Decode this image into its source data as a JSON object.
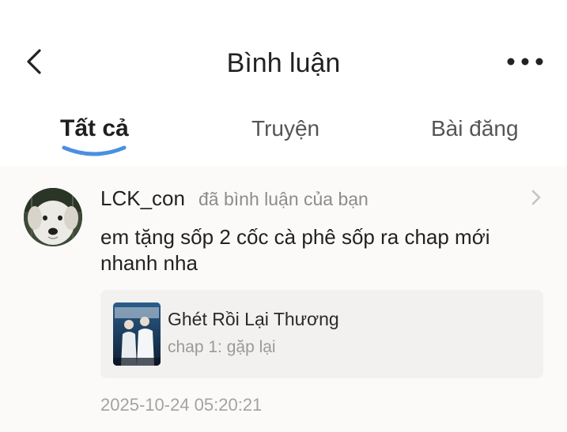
{
  "header": {
    "title": "Bình luận",
    "back_icon": "chevron-left-icon",
    "more_icon": "more-horizontal-icon"
  },
  "tabs": [
    {
      "label": "Tất cả",
      "active": true
    },
    {
      "label": "Truyện",
      "active": false
    },
    {
      "label": "Bài đăng",
      "active": false
    }
  ],
  "colors": {
    "tab_underline": "#4a90e2",
    "content_bg": "#fbfaf8",
    "card_bg": "#f2f1ef",
    "muted_text": "#8c8c8c"
  },
  "notification": {
    "username": "LCK_con",
    "action": "đã bình luận của bạn",
    "comment": "em tặng sốp 2 cốc cà phê sốp ra chap mới nhanh nha",
    "story": {
      "title": "Ghét Rồi Lại Thương",
      "chapter": "chap 1: gặp lại"
    },
    "timestamp": "2025-10-24 05:20:21"
  }
}
